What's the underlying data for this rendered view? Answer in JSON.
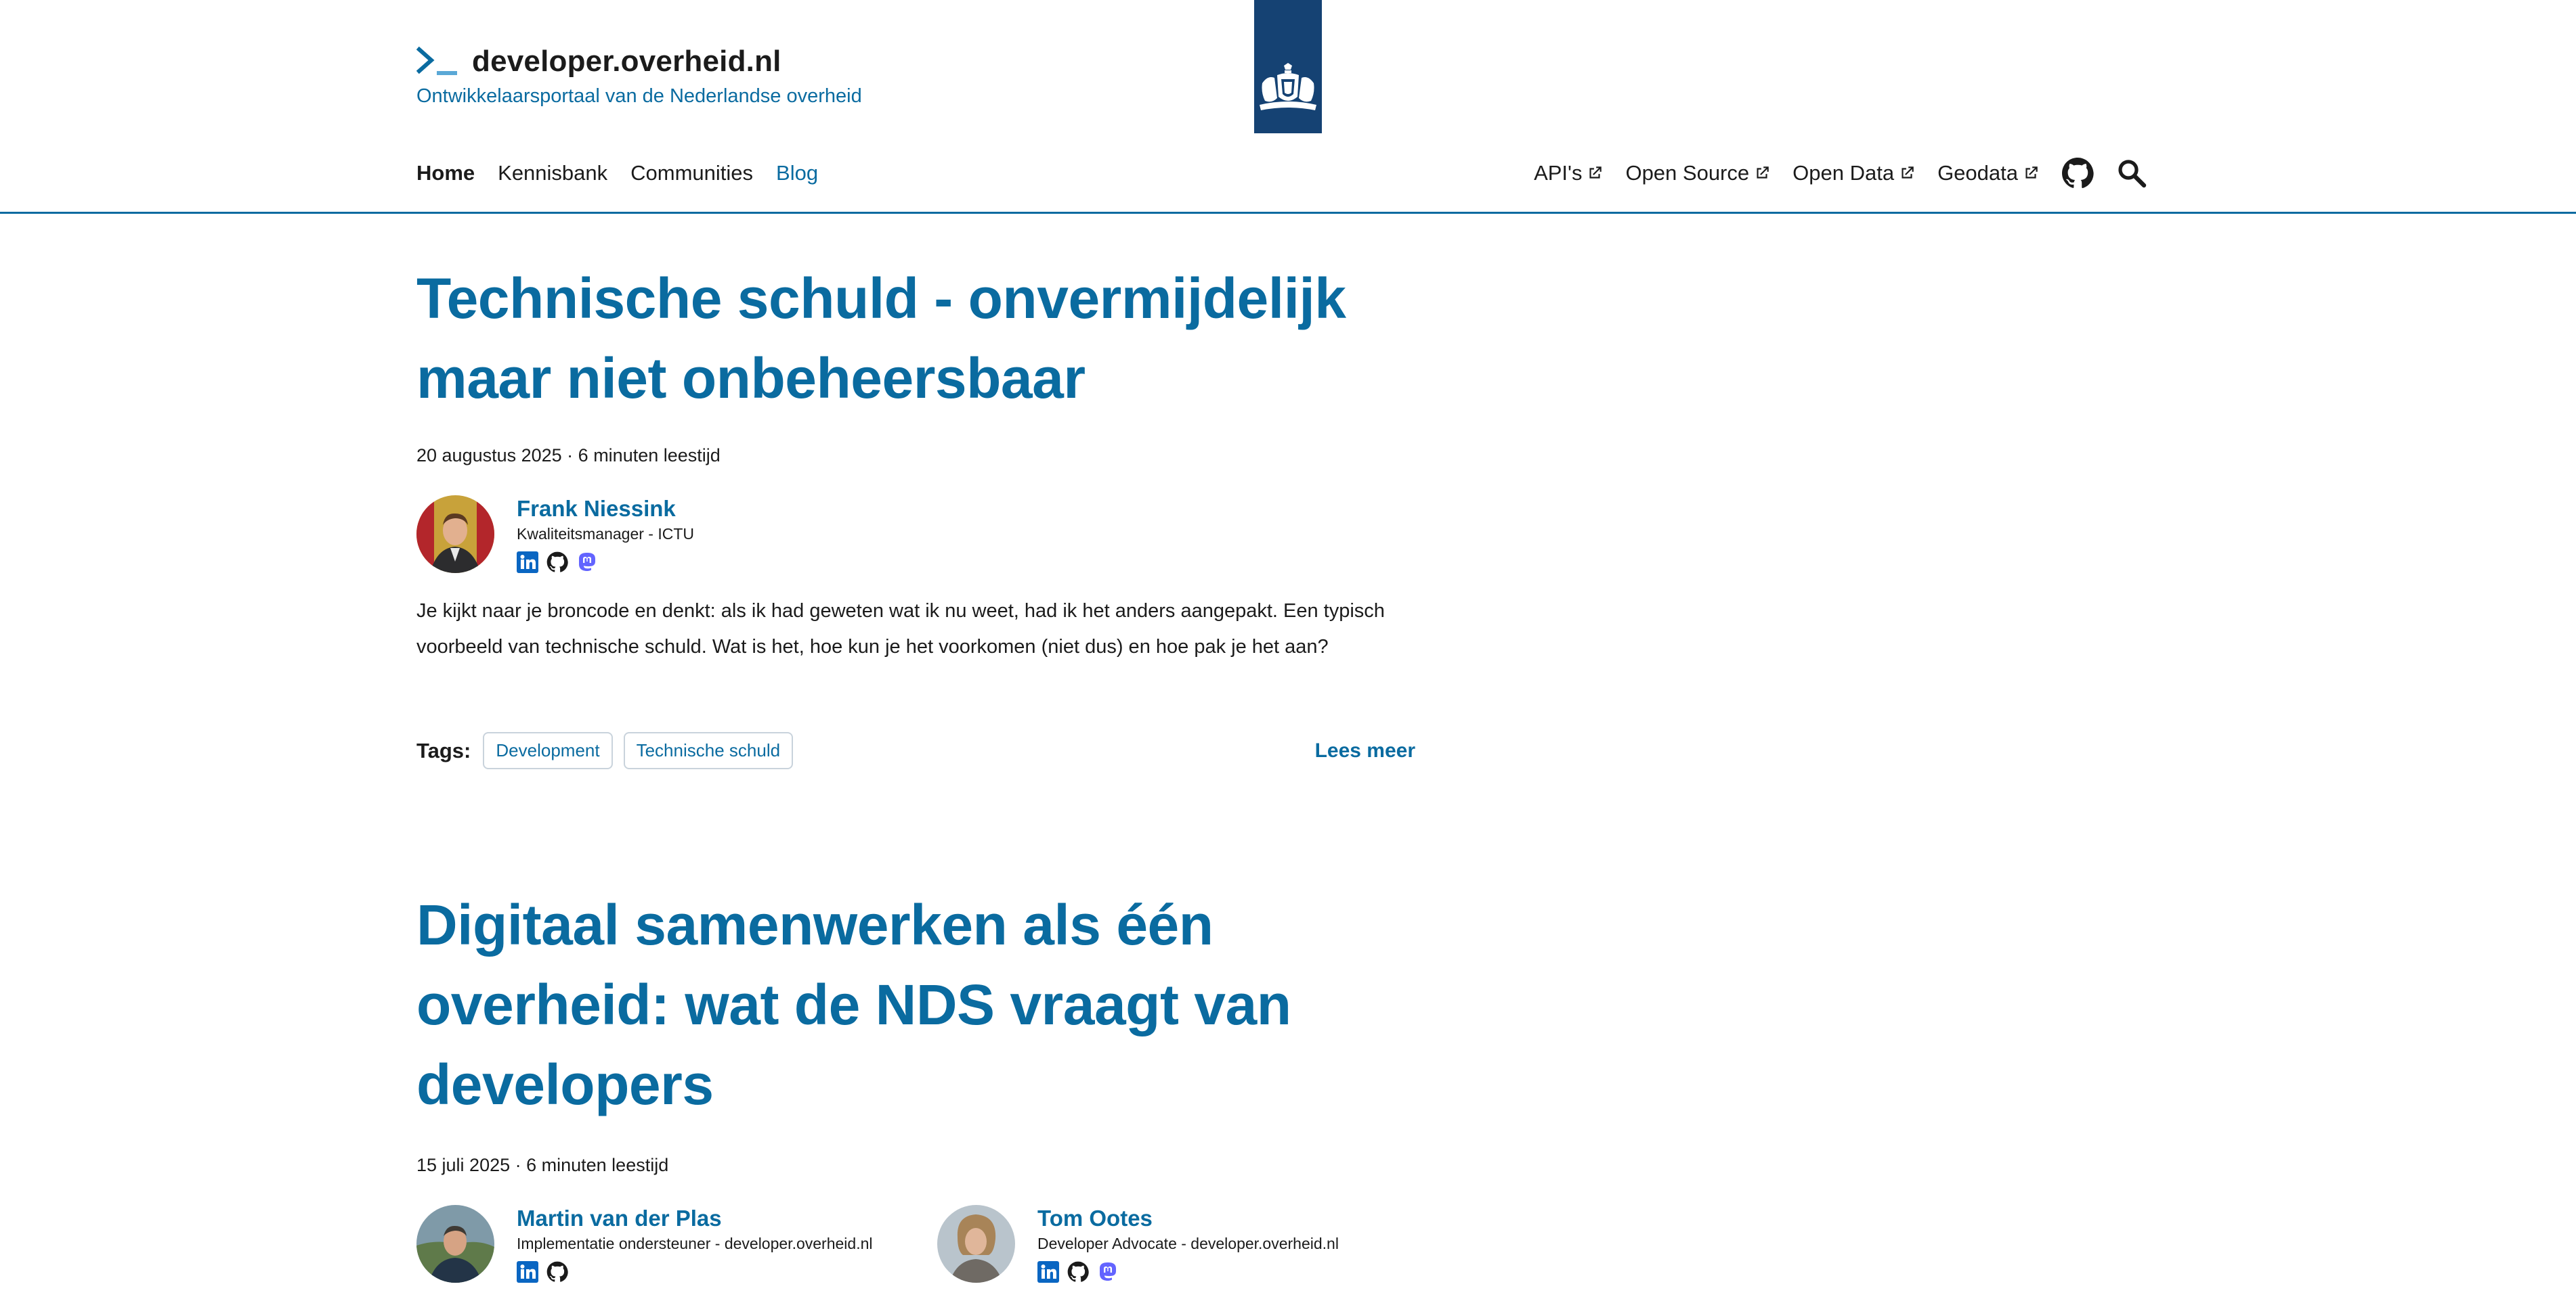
{
  "header": {
    "site_name": "developer.overheid.nl",
    "tagline": "Ontwikkelaarsportaal van de Nederlandse overheid",
    "logo_icon": "terminal-prompt-icon",
    "crest_icon": "rijksoverheid-crest-icon"
  },
  "nav": {
    "left": [
      {
        "label": "Home",
        "state": "active"
      },
      {
        "label": "Kennisbank"
      },
      {
        "label": "Communities"
      },
      {
        "label": "Blog",
        "state": "highlighted"
      }
    ],
    "right": [
      {
        "label": "API's",
        "icon": "external-link-icon"
      },
      {
        "label": "Open Source",
        "icon": "external-link-icon"
      },
      {
        "label": "Open Data",
        "icon": "external-link-icon"
      },
      {
        "label": "Geodata",
        "icon": "external-link-icon"
      }
    ],
    "github_icon": "github-icon",
    "search_icon": "search-icon"
  },
  "articles": [
    {
      "title_lines": [
        "Technische schuld - onvermijdelijk",
        "maar niet onbeheersbaar"
      ],
      "meta": "20 augustus 2025 · 6 minuten leestijd",
      "authors": [
        {
          "name": "Frank Niessink",
          "role": "Kwaliteitsmanager - ICTU",
          "socials": [
            "linkedin-icon",
            "github-icon",
            "mastodon-icon"
          ]
        }
      ],
      "excerpt_lines": [
        "Je kijkt naar je broncode en denkt: als ik had geweten wat ik nu weet, had ik het anders aangepakt. Een typisch",
        "voorbeeld van technische schuld. Wat is het, hoe kun je het voorkomen (niet dus) en hoe pak je het aan?"
      ],
      "tags_label": "Tags:",
      "tags": [
        "Development",
        "Technische schuld"
      ],
      "read_more": "Lees meer"
    },
    {
      "title_lines": [
        "Digitaal samenwerken als één",
        "overheid: wat de NDS vraagt van",
        "developers"
      ],
      "meta": "15 juli 2025 · 6 minuten leestijd",
      "authors": [
        {
          "name": "Martin van der Plas",
          "role": "Implementatie ondersteuner - developer.overheid.nl",
          "socials": [
            "linkedin-icon",
            "github-icon"
          ]
        },
        {
          "name": "Tom Ootes",
          "role": "Developer Advocate - developer.overheid.nl",
          "socials": [
            "linkedin-icon",
            "github-icon",
            "mastodon-icon"
          ]
        }
      ]
    }
  ],
  "colors": {
    "primary_blue": "#0a6ba0",
    "crest_blue": "#154273",
    "text": "#1b1b1b",
    "tag_border": "#c9d3dc"
  }
}
